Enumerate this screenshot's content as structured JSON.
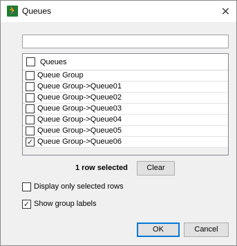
{
  "window": {
    "title": "Queues",
    "icon": "running-man-icon",
    "close_glyph": "✕"
  },
  "search": {
    "value": "",
    "placeholder": ""
  },
  "grid": {
    "header": {
      "label": "Queues",
      "checked": false
    },
    "rows": [
      {
        "label": "Queue Group",
        "checked": false
      },
      {
        "label": "Queue Group->Queue01",
        "checked": false
      },
      {
        "label": "Queue Group->Queue02",
        "checked": false
      },
      {
        "label": "Queue Group->Queue03",
        "checked": false
      },
      {
        "label": "Queue Group->Queue04",
        "checked": false
      },
      {
        "label": "Queue Group->Queue05",
        "checked": false
      },
      {
        "label": "Queue Group->Queue06",
        "checked": true
      }
    ]
  },
  "selection": {
    "count_text": "1 row selected",
    "clear_label": "Clear"
  },
  "options": {
    "display_only_selected": {
      "label": "Display only selected rows",
      "checked": false
    },
    "show_group_labels": {
      "label": "Show group labels",
      "checked": true
    }
  },
  "footer": {
    "ok_label": "OK",
    "cancel_label": "Cancel"
  },
  "colors": {
    "accent": "#0078d7",
    "app_icon_bg": "#1e7d32"
  }
}
